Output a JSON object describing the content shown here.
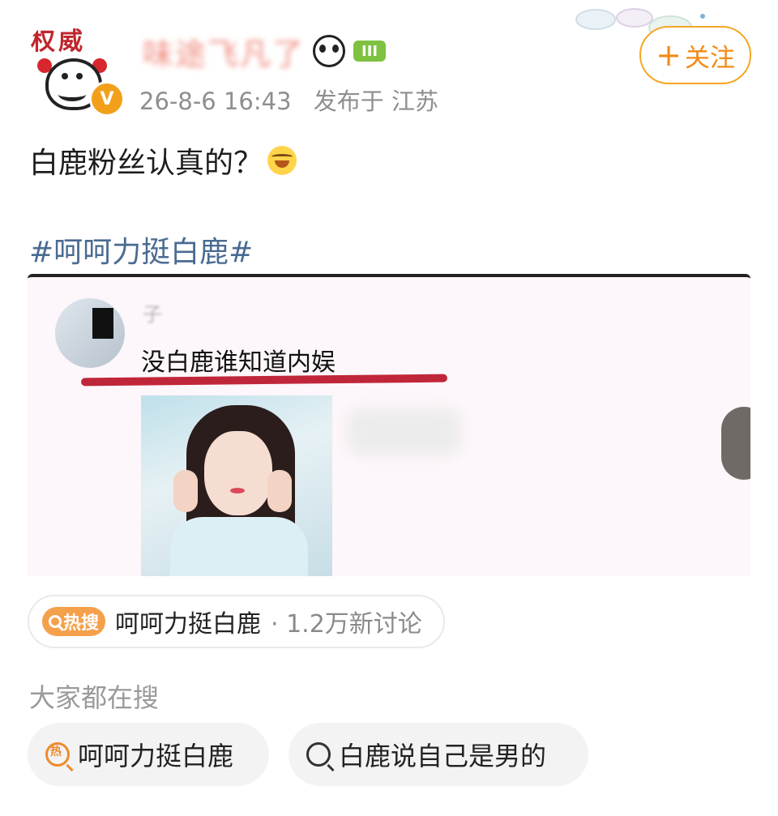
{
  "post": {
    "author_name": "味途飞凡了",
    "avatar_seal_text": "权威",
    "verified_mark": "V",
    "level_badge": "III",
    "timestamp": "26-8-6 16:43",
    "location_label": "发布于 江苏",
    "follow_label": "关注",
    "follow_plus": "+",
    "text": "白鹿粉丝认真的？",
    "hashtag": "#呵呵力挺白鹿#",
    "embedded_screenshot": {
      "commenter_name": "子",
      "quote": "没白鹿谁知道内娱"
    }
  },
  "hot_search": {
    "badge_label": "热搜",
    "title": "呵呵力挺白鹿",
    "count": "· 1.2万新讨论"
  },
  "related_searches": {
    "section_title": "大家都在搜",
    "items": [
      {
        "label": "呵呵力挺白鹿",
        "icon": "hot-search-icon",
        "icon_text": "热"
      },
      {
        "label": "白鹿说自己是男的",
        "icon": "search-icon"
      }
    ]
  },
  "colors": {
    "accent_orange": "#f28a16",
    "hashtag_blue": "#4a6b91",
    "underline_red": "#c0263a",
    "hot_badge": "#f5a04a"
  }
}
